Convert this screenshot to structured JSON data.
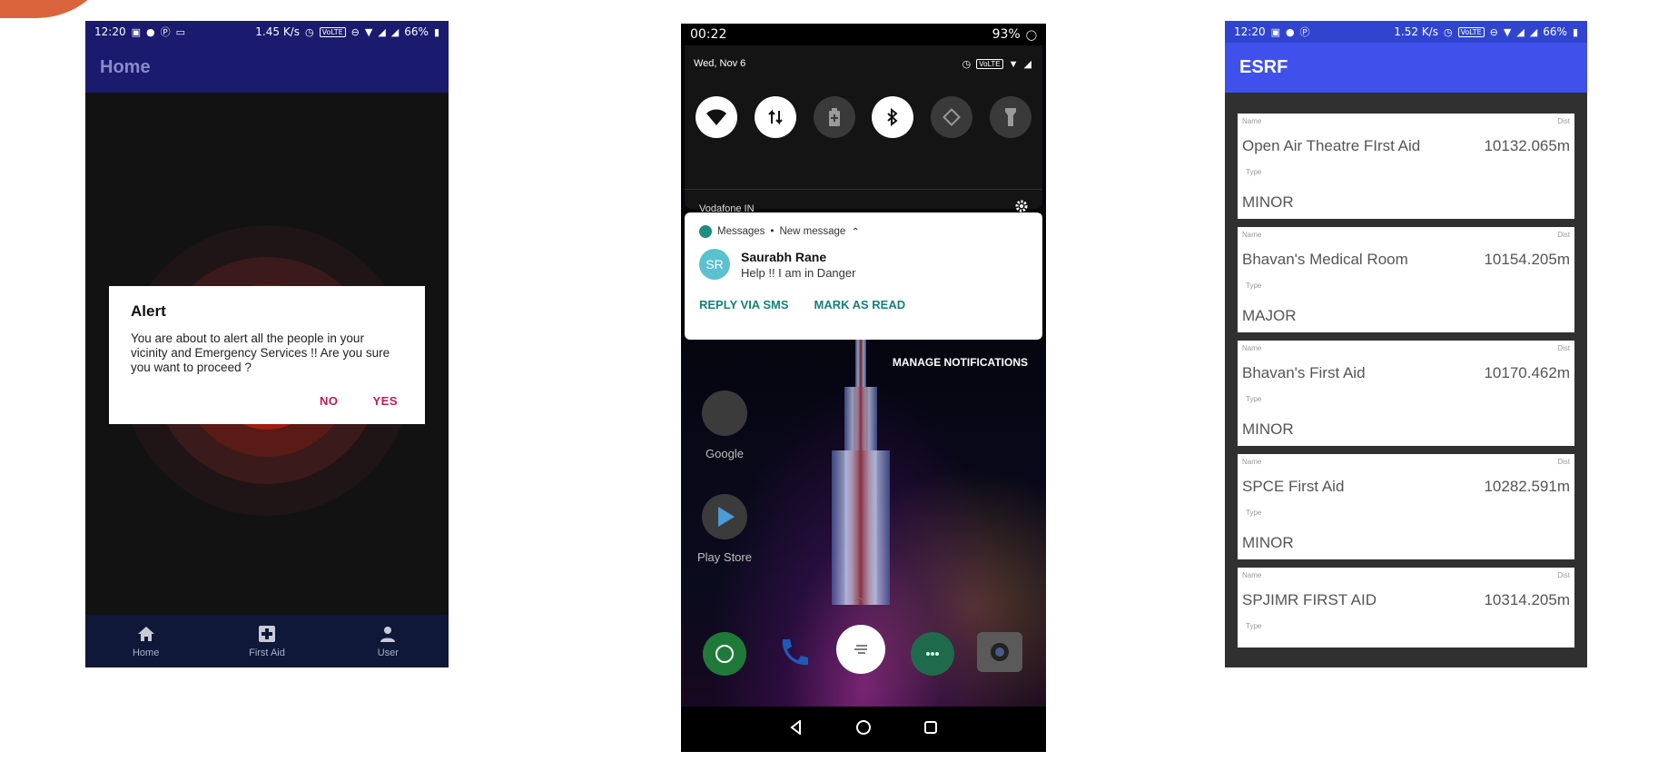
{
  "phone1": {
    "status": {
      "time": "12:20",
      "speed": "1.45 K/s",
      "volte": "VoLTE",
      "battery": "66%"
    },
    "appbar_title": "Home",
    "dialog": {
      "title": "Alert",
      "message": "You are about to alert all the people in your vicinity and Emergency Services !! Are you sure you want to proceed ?",
      "no": "NO",
      "yes": "YES"
    },
    "nav": [
      {
        "label": "Home",
        "icon": "home-icon"
      },
      {
        "label": "First Aid",
        "icon": "first-aid-icon"
      },
      {
        "label": "User",
        "icon": "user-icon"
      }
    ],
    "colors": {
      "appbar": "#1a1a6e",
      "accent": "#c2185b"
    }
  },
  "phone2": {
    "status": {
      "time": "00:22",
      "battery": "93%"
    },
    "date": "Wed, Nov 6",
    "volte": "VoLTE",
    "carrier": "Vodafone IN",
    "notification": {
      "app": "Messages",
      "separator": "•",
      "subtitle": "New message",
      "avatar_initials": "SR",
      "sender": "Saurabh Rane",
      "text": "Help !! I am in Danger",
      "action_reply": "REPLY VIA SMS",
      "action_read": "MARK AS READ"
    },
    "manage": "MANAGE NOTIFICATIONS",
    "apps": [
      {
        "label": "Google",
        "icon": "google-folder-icon"
      },
      {
        "label": "Play Store",
        "icon": "play-store-icon"
      }
    ],
    "dock": [
      "whatsapp-icon",
      "phone-icon",
      "messages-icon",
      "camera-icon"
    ]
  },
  "phone3": {
    "status": {
      "time": "12:20",
      "speed": "1.52 K/s",
      "volte": "VoLTE",
      "battery": "66%"
    },
    "appbar_title": "ESRF",
    "captions": {
      "name": "Name",
      "dist": "Dist",
      "type": "Type"
    },
    "items": [
      {
        "name": "Open Air Theatre FIrst Aid",
        "dist": "10132.065m",
        "type": "MINOR"
      },
      {
        "name": "Bhavan's Medical Room",
        "dist": "10154.205m",
        "type": "MAJOR"
      },
      {
        "name": "Bhavan's First Aid",
        "dist": "10170.462m",
        "type": "MINOR"
      },
      {
        "name": "SPCE First Aid",
        "dist": "10282.591m",
        "type": "MINOR"
      },
      {
        "name": "SPJIMR FIRST AID",
        "dist": "10314.205m",
        "type": ""
      }
    ],
    "colors": {
      "appbar": "#3f51ea"
    }
  }
}
